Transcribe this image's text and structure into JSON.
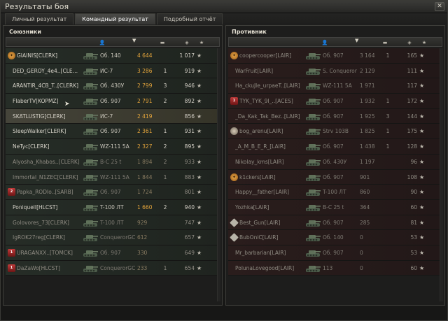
{
  "window": {
    "title": "Результаты боя",
    "close_label": "✕"
  },
  "tabs": [
    {
      "label": "Личный результат",
      "active": false
    },
    {
      "label": "Командный результат",
      "active": true
    },
    {
      "label": "Подробный отчёт",
      "active": false
    }
  ],
  "allies": {
    "title": "Союзники",
    "rows": [
      {
        "badge": "medal",
        "badge_text": "✦",
        "name": "GIAINIS[CLERK]",
        "tank": "Об. 140",
        "damage": "4 644",
        "kills": "",
        "xp": "1 017",
        "alive": true,
        "highlight": false
      },
      {
        "badge": "",
        "badge_text": "",
        "name": "DED_GEROY_4e4..[CLERK]",
        "tank": "ИС-7",
        "damage": "3 286",
        "kills": "1",
        "xp": "919",
        "alive": true,
        "highlight": false
      },
      {
        "badge": "",
        "badge_text": "",
        "name": "ARANTIR_4CB_T..[CLERK]",
        "tank": "Об. 430У",
        "damage": "2 799",
        "kills": "3",
        "xp": "946",
        "alive": true,
        "highlight": false
      },
      {
        "badge": "",
        "badge_text": "",
        "name": "FlaberTV[KOPMZ]",
        "tank": "Об. 907",
        "damage": "2 791",
        "kills": "2",
        "xp": "892",
        "alive": true,
        "highlight": false
      },
      {
        "badge": "",
        "badge_text": "",
        "name": "SKATLUSTIG[CLERK]",
        "tank": "ИС-7",
        "damage": "2 419",
        "kills": "",
        "xp": "856",
        "alive": true,
        "highlight": true
      },
      {
        "badge": "",
        "badge_text": "",
        "name": "SleepWalker[CLERK]",
        "tank": "Об. 907",
        "damage": "2 361",
        "kills": "1",
        "xp": "931",
        "alive": true,
        "highlight": false
      },
      {
        "badge": "",
        "badge_text": "",
        "name": "NeTyc[CLERK]",
        "tank": "WZ-111 5A",
        "damage": "2 327",
        "kills": "2",
        "xp": "895",
        "alive": true,
        "highlight": false
      },
      {
        "badge": "",
        "badge_text": "",
        "name": "Alyosha_Khabos..[CLERK]",
        "tank": "B-C 25 t",
        "damage": "1 894",
        "kills": "2",
        "xp": "933",
        "alive": false,
        "highlight": false
      },
      {
        "badge": "",
        "badge_text": "",
        "name": "Immortal_N1ZEC[CLERK]",
        "tank": "WZ-111 5A",
        "damage": "1 844",
        "kills": "1",
        "xp": "883",
        "alive": false,
        "highlight": false
      },
      {
        "badge": "platoon",
        "badge_text": "2",
        "name": "Papka_RODIo..[SARB]",
        "tank": "Об. 907",
        "damage": "1 724",
        "kills": "",
        "xp": "801",
        "alive": false,
        "highlight": false
      },
      {
        "badge": "",
        "badge_text": "",
        "name": "PoniquelI[HLCST]",
        "tank": "T-100 ЛТ",
        "damage": "1 660",
        "kills": "2",
        "xp": "940",
        "alive": true,
        "highlight": false
      },
      {
        "badge": "",
        "badge_text": "",
        "name": "Golovores_73[CLERK]",
        "tank": "T-100 ЛТ",
        "damage": "929",
        "kills": "",
        "xp": "747",
        "alive": false,
        "highlight": false
      },
      {
        "badge": "",
        "badge_text": "",
        "name": "IgROK27reg[CLERK]",
        "tank": "ConquerorGC",
        "damage": "612",
        "kills": "",
        "xp": "657",
        "alive": false,
        "highlight": false
      },
      {
        "badge": "platoon",
        "badge_text": "1",
        "name": "URAGANXX..[TOMCK]",
        "tank": "Об. 907",
        "damage": "330",
        "kills": "",
        "xp": "649",
        "alive": false,
        "highlight": false
      },
      {
        "badge": "platoon",
        "badge_text": "1",
        "name": "DaZaWo[HLCST]",
        "tank": "ConquerorGC",
        "damage": "233",
        "kills": "1",
        "xp": "654",
        "alive": false,
        "highlight": false
      }
    ]
  },
  "enemies": {
    "title": "Противник",
    "rows": [
      {
        "badge": "medal",
        "badge_text": "✦",
        "name": "coopercooper[LAIR]",
        "tank": "Об. 907",
        "damage": "3 164",
        "kills": "1",
        "xp": "165",
        "alive": false,
        "highlight": false
      },
      {
        "badge": "",
        "badge_text": "",
        "name": "WarFruit[LAIR]",
        "tank": "S. Conqueror",
        "damage": "2 129",
        "kills": "",
        "xp": "111",
        "alive": false,
        "highlight": false
      },
      {
        "badge": "",
        "badge_text": "",
        "name": "Ha_ckuJle_urpaeT..[LAIR]",
        "tank": "WZ-111 5A",
        "damage": "1 971",
        "kills": "",
        "xp": "117",
        "alive": false,
        "highlight": false
      },
      {
        "badge": "platoon",
        "badge_text": "1",
        "name": "TYK_TYK_9I_..[ACES]",
        "tank": "Об. 907",
        "damage": "1 932",
        "kills": "1",
        "xp": "172",
        "alive": false,
        "highlight": false
      },
      {
        "badge": "",
        "badge_text": "",
        "name": "_Da_Kak_Tak_Bez..[LAIR]",
        "tank": "Об. 907",
        "damage": "1 925",
        "kills": "3",
        "xp": "144",
        "alive": false,
        "highlight": false
      },
      {
        "badge": "clan",
        "badge_text": "",
        "name": "bog_arenu[LAIR]",
        "tank": "Strv 103B",
        "damage": "1 825",
        "kills": "1",
        "xp": "175",
        "alive": false,
        "highlight": false
      },
      {
        "badge": "",
        "badge_text": "",
        "name": "_A_M_B_E_R_[LAIR]",
        "tank": "Об. 907",
        "damage": "1 438",
        "kills": "1",
        "xp": "128",
        "alive": false,
        "highlight": false
      },
      {
        "badge": "",
        "badge_text": "",
        "name": "Nikolay_kms[LAIR]",
        "tank": "Об. 430У",
        "damage": "1 197",
        "kills": "",
        "xp": "96",
        "alive": false,
        "highlight": false
      },
      {
        "badge": "medal",
        "badge_text": "✦",
        "name": "k1ckers[LAIR]",
        "tank": "Об. 907",
        "damage": "901",
        "kills": "",
        "xp": "108",
        "alive": false,
        "highlight": false
      },
      {
        "badge": "",
        "badge_text": "",
        "name": "Happy__father[LAIR]",
        "tank": "T-100 ЛТ",
        "damage": "860",
        "kills": "",
        "xp": "90",
        "alive": false,
        "highlight": false
      },
      {
        "badge": "",
        "badge_text": "",
        "name": "Yozhka[LAIR]",
        "tank": "B-C 25 t",
        "damage": "364",
        "kills": "",
        "xp": "60",
        "alive": false,
        "highlight": false
      },
      {
        "badge": "diamond",
        "badge_text": "",
        "name": "Best_Gun[LAIR]",
        "tank": "Об. 907",
        "damage": "285",
        "kills": "",
        "xp": "81",
        "alive": false,
        "highlight": false
      },
      {
        "badge": "diamond",
        "badge_text": "",
        "name": "BubOniC[LAIR]",
        "tank": "Об. 140",
        "damage": "0",
        "kills": "",
        "xp": "53",
        "alive": false,
        "highlight": false
      },
      {
        "badge": "",
        "badge_text": "",
        "name": "Mr_barbarian[LAIR]",
        "tank": "Об. 907",
        "damage": "0",
        "kills": "",
        "xp": "53",
        "alive": false,
        "highlight": false
      },
      {
        "badge": "",
        "badge_text": "",
        "name": "PolunaLovegood[LAIR]",
        "tank": "113",
        "damage": "0",
        "kills": "",
        "xp": "60",
        "alive": false,
        "highlight": false
      }
    ]
  },
  "star_glyph": "★",
  "colors": {
    "ally_damage": "#e5a53c",
    "enemy_damage": "#8e6b62",
    "highlight_row": "#45443a"
  },
  "icons": {
    "header_col_1": "player-icon",
    "header_col_2": "sort-arrow-icon",
    "header_col_3": "tank-kill-icon",
    "header_col_4": "xp-icon",
    "header_col_5": "star-icon"
  }
}
